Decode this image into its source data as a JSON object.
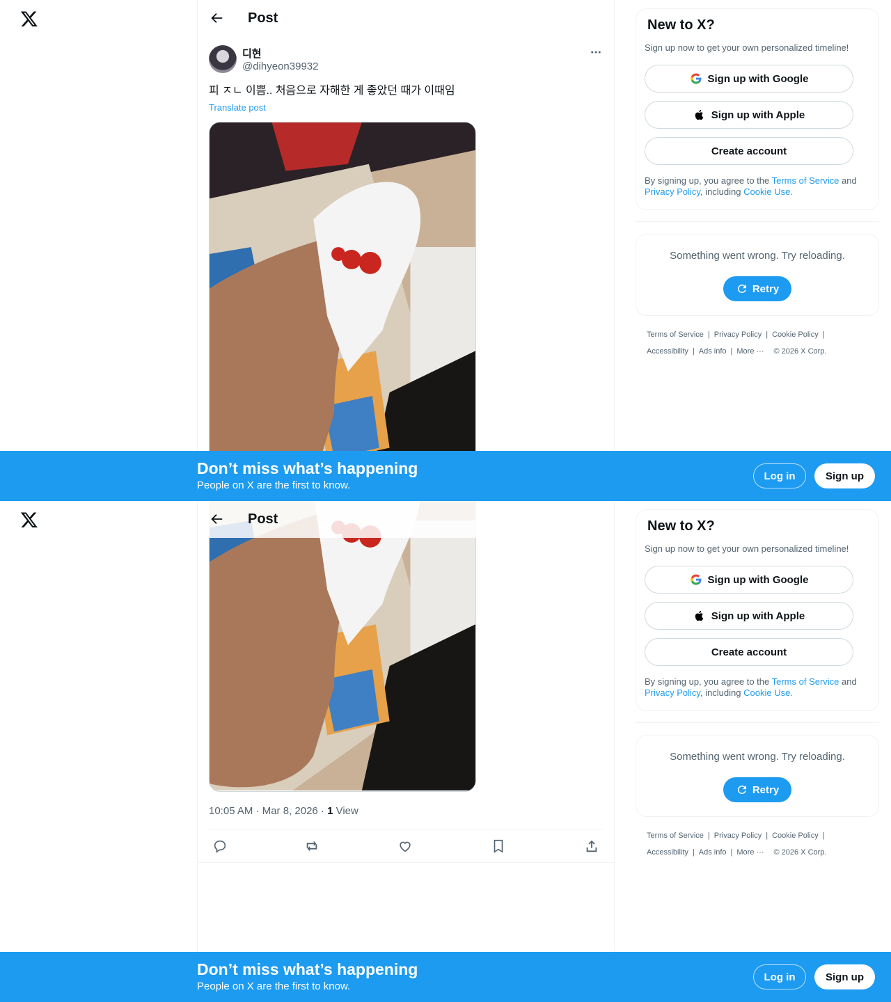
{
  "header": {
    "title": "Post"
  },
  "post": {
    "display_name": "디현",
    "handle": "@dihyeon39932",
    "text": "피 ㅈㄴ 이쁨.. 처음으로 자해한 게 좋았던 때가 이때임",
    "translate_label": "Translate post",
    "time": "10:05 AM · Mar 8, 2026 · ",
    "views_count": "1",
    "views_label": " View"
  },
  "signup_card": {
    "title": "New to X?",
    "subtitle": "Sign up now to get your own personalized timeline!",
    "google_label": "Sign up with Google",
    "apple_label": "Sign up with Apple",
    "create_label": "Create account",
    "legal_prefix": "By signing up, you agree to the ",
    "terms_link": "Terms of Service",
    "legal_and": " and",
    "privacy_link": "Privacy Policy",
    "legal_including": ", including ",
    "cookie_link": "Cookie Use."
  },
  "error_card": {
    "message": "Something went wrong. Try reloading.",
    "retry_label": "Retry"
  },
  "footer": {
    "terms": "Terms of Service",
    "privacy": "Privacy Policy",
    "cookie": "Cookie Policy",
    "accessibility": "Accessibility",
    "ads": "Ads info",
    "more": "More ···",
    "copyright": "© 2026 X Corp."
  },
  "banner": {
    "title": "Don’t miss what’s happening",
    "subtitle": "People on X are the first to know.",
    "login_label": "Log in",
    "signup_label": "Sign up"
  },
  "colors": {
    "accent": "#1d9bf0",
    "text": "#0f1419",
    "muted": "#536471",
    "border": "#eff3f4"
  },
  "icons": [
    "x-logo-icon",
    "back-arrow-icon",
    "more-icon",
    "google-icon",
    "apple-icon",
    "retry-icon",
    "reply-icon",
    "repost-icon",
    "like-icon",
    "bookmark-icon",
    "share-icon"
  ]
}
